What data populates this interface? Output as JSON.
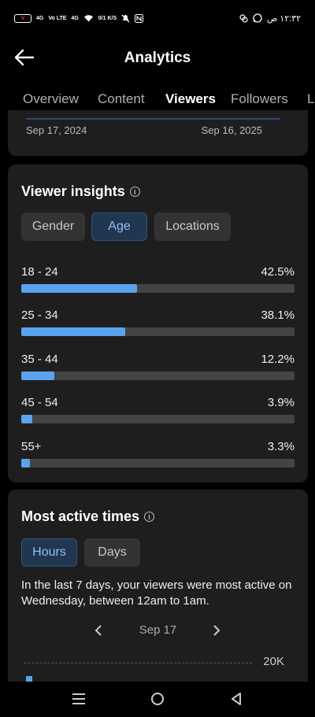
{
  "status_bar": {
    "battery": "V",
    "network_1": "4G",
    "network_2": "Vo LTE",
    "network_3": "4G",
    "speed": "0/1 K/S",
    "time": "١٢:٣٢ ص"
  },
  "header": {
    "title": "Analytics"
  },
  "tabs": [
    {
      "label": "Overview"
    },
    {
      "label": "Content"
    },
    {
      "label": "Viewers"
    },
    {
      "label": "Followers"
    },
    {
      "label": "L"
    }
  ],
  "range": {
    "start": "Sep 17, 2024",
    "end": "Sep 16, 2025"
  },
  "insights": {
    "title": "Viewer insights",
    "chips": [
      "Gender",
      "Age",
      "Locations"
    ],
    "selected": "Age",
    "rows": [
      {
        "label": "18 - 24",
        "pct": "42.5%",
        "value": 42.5
      },
      {
        "label": "25 - 34",
        "pct": "38.1%",
        "value": 38.1
      },
      {
        "label": "35 - 44",
        "pct": "12.2%",
        "value": 12.2
      },
      {
        "label": "45 - 54",
        "pct": "3.9%",
        "value": 3.9
      },
      {
        "label": "55+",
        "pct": "3.3%",
        "value": 3.3
      }
    ]
  },
  "active_times": {
    "title": "Most active times",
    "chips": [
      "Hours",
      "Days"
    ],
    "selected": "Hours",
    "description": "In the last 7 days, your viewers were most active on Wednesday, between 12am to 1am.",
    "date": "Sep 17",
    "chart_max_label": "20K"
  },
  "colors": {
    "accent": "#5aa3ef",
    "card": "#1e1e1e",
    "background": "#000000"
  }
}
